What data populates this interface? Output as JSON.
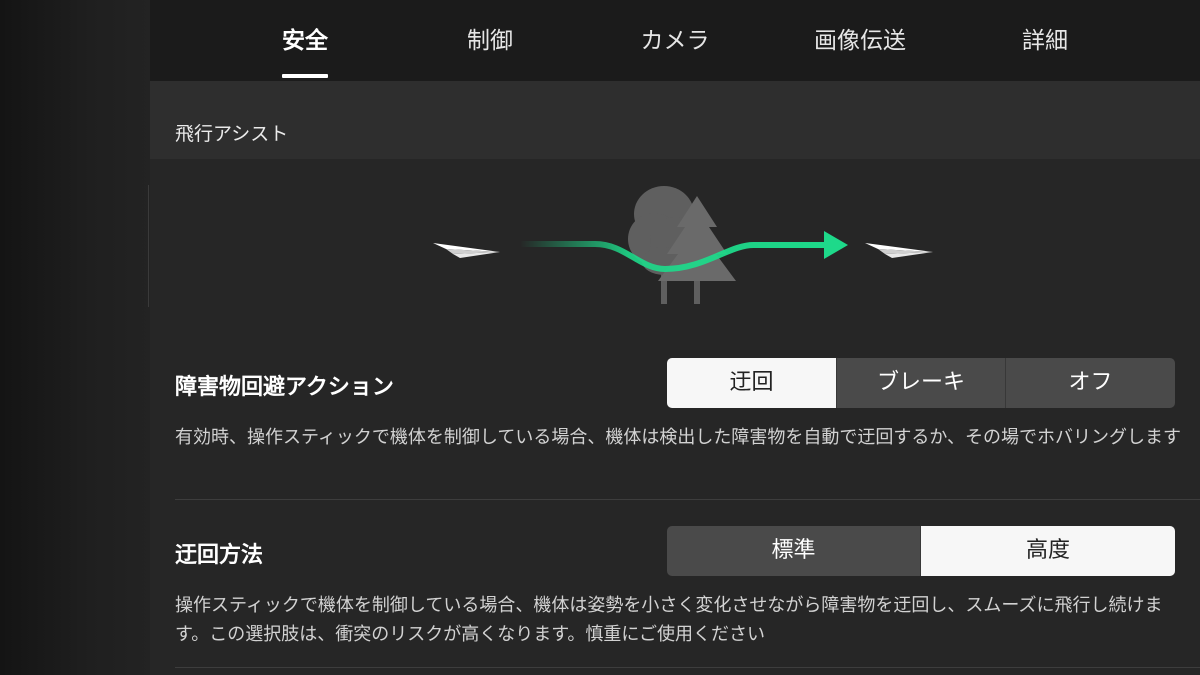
{
  "tabs": [
    {
      "label": "安全",
      "active": true
    },
    {
      "label": "制御",
      "active": false
    },
    {
      "label": "カメラ",
      "active": false
    },
    {
      "label": "画像伝送",
      "active": false
    },
    {
      "label": "詳細",
      "active": false
    }
  ],
  "section": {
    "title": "飛行アシスト"
  },
  "illustration": {
    "icons": [
      "paper-plane-icon",
      "trees-icon",
      "path-arrow-icon",
      "paper-plane-icon"
    ],
    "path_color": "#1ed98a"
  },
  "obstacle_action": {
    "title": "障害物回避アクション",
    "options": [
      "迂回",
      "ブレーキ",
      "オフ"
    ],
    "selected": "迂回",
    "description": "有効時、操作スティックで機体を制御している場合、機体は検出した障害物を自動で迂回するか、その場でホバリングします"
  },
  "bypass_method": {
    "title": "迂回方法",
    "options": [
      "標準",
      "高度"
    ],
    "selected": "高度",
    "description": "操作スティックで機体を制御している場合、機体は姿勢を小さく変化させながら障害物を迂回し、スムーズに飛行し続けます。この選択肢は、衝突のリスクが高くなります。慎重にご使用ください"
  },
  "colors": {
    "background": "#262626",
    "tabbar": "#1b1b1b",
    "accent_green": "#1ed98a",
    "selected_option": "#f7f7f7"
  }
}
